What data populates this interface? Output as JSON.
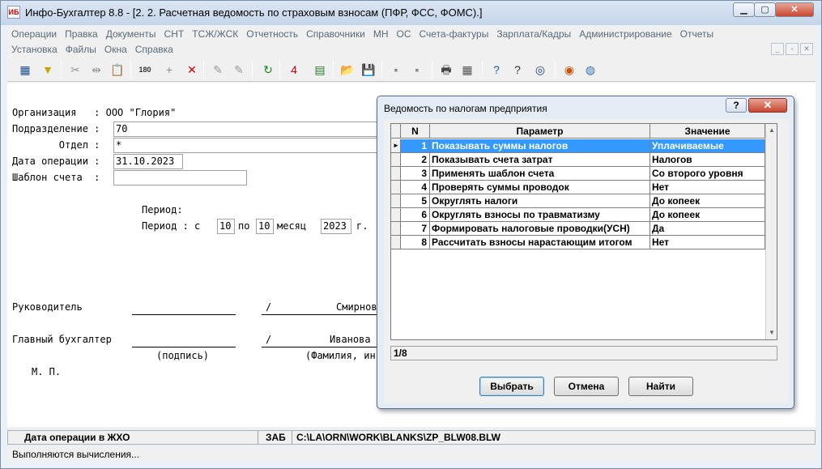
{
  "window": {
    "title": "Инфо-Бухгалтер 8.8 - [2. 2. Расчетная ведомость по страховым взносам (ПФР, ФСС, ФОМС).]",
    "icon_text": "ИБ",
    "minimize": "▁",
    "maximize": "▢",
    "close": "✕"
  },
  "menu": {
    "row1": [
      "Операции",
      "Правка",
      "Документы",
      "СНТ",
      "ТСЖ/ЖСК",
      "Отчетность",
      "Справочники",
      "МН",
      "ОС",
      "Счета-фактуры",
      "Зарплата/Кадры",
      "Администрирование",
      "Отчеты"
    ],
    "row2": [
      "Установка",
      "Файлы",
      "Окна",
      "Справка"
    ],
    "mdi_min": "_",
    "mdi_restore": "▫",
    "mdi_close": "✕"
  },
  "toolbar": {
    "icons": [
      "grid-icon",
      "filter-icon",
      "cut-icon",
      "split-icon",
      "paste-icon",
      "number-icon",
      "add-icon",
      "delete-icon",
      "tool1-icon",
      "tool2-icon",
      "refresh-icon",
      "calendar-icon",
      "calculator-icon",
      "open-folder-icon",
      "save-icon",
      "block1-icon",
      "block2-icon",
      "print-icon",
      "preview-icon",
      "help-icon",
      "context-help-icon",
      "compass-icon",
      "lifebuoy-icon",
      "globe-icon"
    ],
    "glyphs": [
      "▦",
      "▼",
      "✂",
      "⇹",
      "📋",
      "180",
      "+",
      "✕",
      "✎",
      "✎",
      "↻",
      "4",
      "▤",
      "📂",
      "💾",
      "▪",
      "▪",
      "🖶",
      "▦",
      "?",
      "?",
      "◎",
      "◉",
      "◍"
    ]
  },
  "form": {
    "org_label": "Организация   : ООО \"Глория\"",
    "division_label": "Подразделение :",
    "division_value": "70",
    "dept_label": "        Отдел :",
    "dept_value": "*",
    "date_label": "Дата операции :",
    "date_value": "31.10.2023",
    "template_label": "Шаблон счета  :",
    "template_value": "",
    "period_title": "Период:",
    "period_prefix": "Период : с",
    "period_from": "10",
    "period_to_label": "по",
    "period_to": "10",
    "month_label": "месяц",
    "year": "2023",
    "year_suffix": "г.",
    "head_label": "Руководитель",
    "head_slash": "/",
    "head_name": "Смирнов",
    "accountant_label": "Главный бухгалтер",
    "accountant_slash": "/",
    "accountant_name": "Иванова",
    "signature_caption": "(подпись)",
    "name_caption": "(Фамилия, ин",
    "stamp": "М. П."
  },
  "status": {
    "left": "Дата операции в ЖХО",
    "mid": "ЗАБ",
    "path": "C:\\LA\\ORN\\WORK\\BLANKS\\ZP_BLW08.BLW",
    "bottom": "Выполняются вычисления..."
  },
  "dialog": {
    "title": "Ведомость по налогам предприятия",
    "help": "?",
    "close": "✕",
    "columns": [
      "N",
      "Параметр",
      "Значение"
    ],
    "rows": [
      {
        "n": "1",
        "param": "Показывать суммы налогов",
        "value": "Уплачиваемые"
      },
      {
        "n": "2",
        "param": "Показывать счета затрат",
        "value": "Налогов"
      },
      {
        "n": "3",
        "param": "Применять шаблон счета",
        "value": "Со второго уровня"
      },
      {
        "n": "4",
        "param": "Проверять суммы проводок",
        "value": "Нет"
      },
      {
        "n": "5",
        "param": "Округлять налоги",
        "value": "До копеек"
      },
      {
        "n": "6",
        "param": "Округлять взносы по травматизму",
        "value": "До копеек"
      },
      {
        "n": "7",
        "param": "Формировать налоговые проводки(УСН)",
        "value": "Да"
      },
      {
        "n": "8",
        "param": "Рассчитать взносы нарастающим итогом",
        "value": "Нет"
      }
    ],
    "counter": "1/8",
    "buttons": {
      "select": "Выбрать",
      "cancel": "Отмена",
      "find": "Найти"
    },
    "scroll_up": "▲",
    "scroll_down": "▼",
    "row_marker": "►"
  }
}
